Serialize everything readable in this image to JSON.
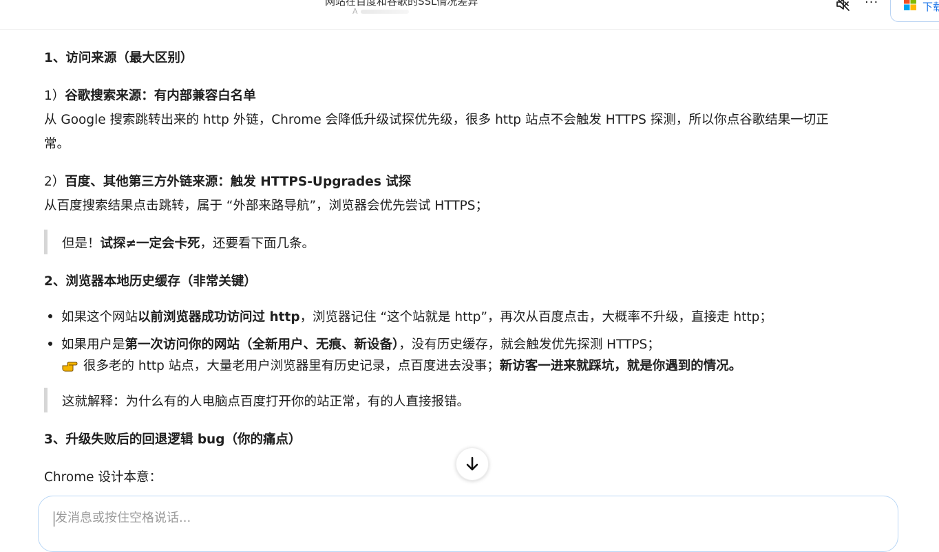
{
  "header": {
    "title": "网站在百度和谷歌的SSL情况差异",
    "subtitle": "A",
    "more_label": "···",
    "download_label": "下载"
  },
  "sections": {
    "s1_heading": "1、访问来源（最大区别）",
    "s1_p1_prefix": "1）",
    "s1_p1_bold": "谷歌搜索来源：有内部兼容白名单",
    "s1_p1_body_line1": "从 Google 搜索跳转出来的 http 外链，Chrome 会降低升级试探优先级，很多 http 站点不会触发 HTTPS 探测，所以你点谷歌结果一切正",
    "s1_p1_body_line2": "常。",
    "s1_p2_prefix": "2）",
    "s1_p2_bold": "百度、其他第三方外链来源：触发 HTTPS-Upgrades 试探",
    "s1_p2_body": "从百度搜索结果点击跳转，属于 “外部来路导航”，浏览器会优先尝试 HTTPS；",
    "quote1_prefix": "但是！",
    "quote1_bold": "试探≠一定会卡死",
    "quote1_suffix": "，还要看下面几条。",
    "s2_heading": "2、浏览器本地历史缓存（非常关键）",
    "b1_prefix": "如果这个网站",
    "b1_bold": "以前浏览器成功访问过 http",
    "b1_suffix": "，浏览器记住 “这个站就是 http”，再次从百度点击，大概率不升级，直接走 http；",
    "b2_prefix": "如果用户是",
    "b2_bold": "第一次访问你的网站（全新用户、无痕、新设备）",
    "b2_suffix": "，没有历史缓存，就会触发优先探测 HTTPS；",
    "b2_line2_text": "很多老的 http 站点，大量老用户浏览器里有历史记录，点百度进去没事；",
    "b2_line2_bold": "新访客一进来就踩坑，就是你遇到的情况。",
    "quote2": "这就解释：为什么有的人电脑点百度打开你的站正常，有的人直接报错。",
    "s3_heading": "3、升级失败后的回退逻辑 bug（你的痛点）",
    "s3_p1": "Chrome 设计本意："
  },
  "composer": {
    "placeholder": "发消息或按住空格说话..."
  },
  "icons": {
    "mute": "speaker-mute-icon",
    "more": "more-icon",
    "microsoft": "microsoft-logo-icon",
    "hand": "pointing-hand-icon",
    "scroll_down": "arrow-down-icon"
  },
  "colors": {
    "accent": "#1a73e8",
    "quote_bar": "#d6d6d6",
    "hand": "#f4b400"
  }
}
